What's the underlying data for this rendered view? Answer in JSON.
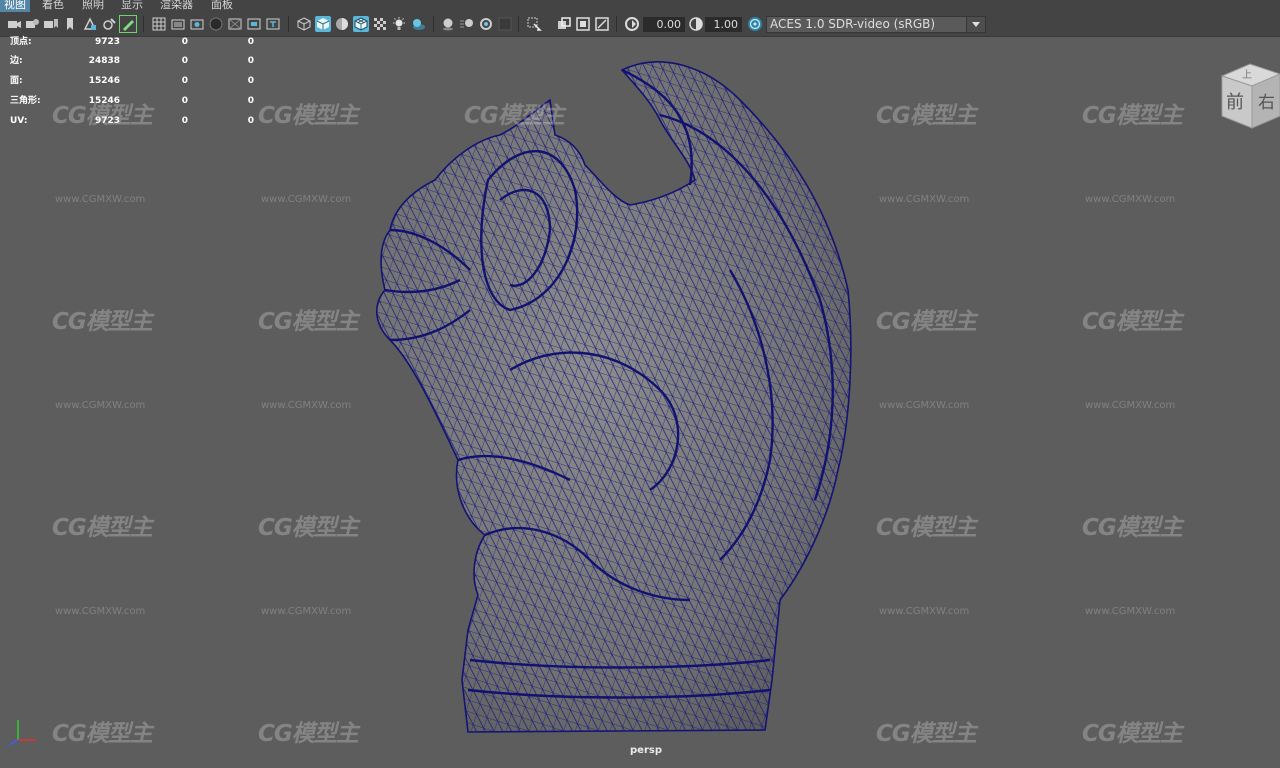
{
  "menu": [
    "视图",
    "着色",
    "照明",
    "显示",
    "渲染器",
    "面板"
  ],
  "toolbar": {
    "exposure_value": "0.00",
    "gamma_value": "1.00",
    "color_space": "ACES 1.0 SDR-video (sRGB)"
  },
  "hud": {
    "rows": [
      {
        "label": "顶点:",
        "v1": "9723",
        "v2": "0",
        "v3": "0"
      },
      {
        "label": "边:",
        "v1": "24838",
        "v2": "0",
        "v3": "0"
      },
      {
        "label": "面:",
        "v1": "15246",
        "v2": "0",
        "v3": "0"
      },
      {
        "label": "三角形:",
        "v1": "15246",
        "v2": "0",
        "v3": "0"
      },
      {
        "label": "UV:",
        "v1": "9723",
        "v2": "0",
        "v3": "0"
      }
    ]
  },
  "watermark": {
    "logo": "CG模型主",
    "url": "www.CGMXW.com"
  },
  "viewcube": {
    "front": "前",
    "right": "右",
    "top": "上"
  },
  "camera_label": "persp",
  "colors": {
    "wireframe": "#1a1a8c",
    "viewport_bg": "#5d5d5d",
    "menu_active": "#5285a6",
    "toolbar_highlight": "#5bb7d8"
  }
}
